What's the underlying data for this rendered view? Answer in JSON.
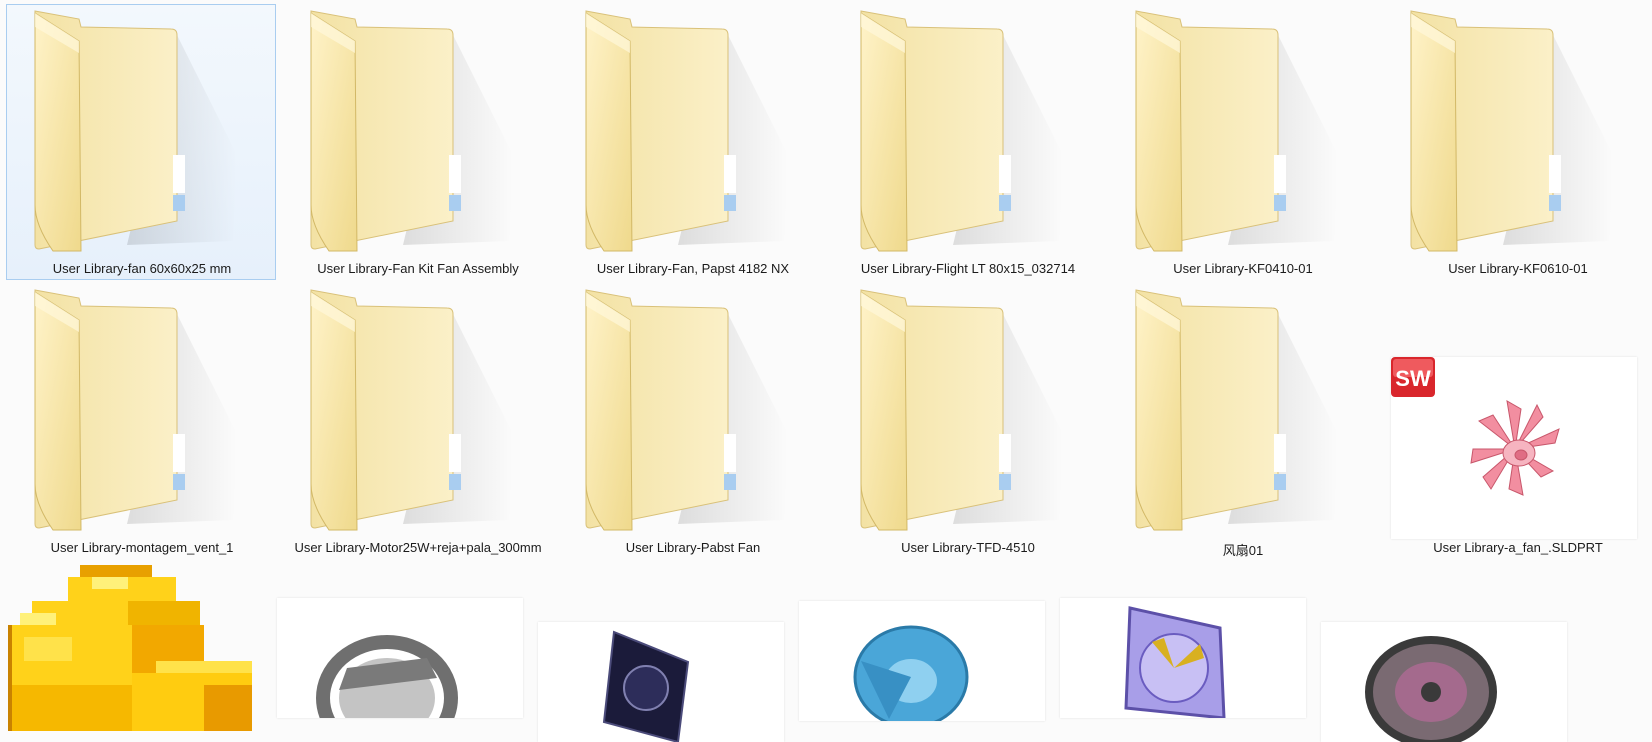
{
  "items_row1": [
    {
      "label": "User Library-fan 60x60x25 mm"
    },
    {
      "label": "User Library-Fan Kit Fan Assembly"
    },
    {
      "label": "User Library-Fan, Papst 4182 NX"
    },
    {
      "label": "User Library-Flight LT 80x15_032714"
    },
    {
      "label": "User Library-KF0410-01"
    },
    {
      "label": "User Library-KF0610-01"
    }
  ],
  "items_row2": [
    {
      "label": "User Library-montagem_vent_1"
    },
    {
      "label": "User Library-Motor25W+reja+pala_300mm"
    },
    {
      "label": "User Library-Pabst Fan"
    },
    {
      "label": "User Library-TFD-4510"
    },
    {
      "label": "风扇01"
    },
    {
      "label": "User Library-a_fan_.SLDPRT"
    }
  ],
  "badge": {
    "text": "SW"
  },
  "colors": {
    "folder": "#f4e3a6",
    "selection_bg": "#e6f0fb",
    "selection_border": "#a9cdf0",
    "sw_badge": "#d9262c"
  }
}
